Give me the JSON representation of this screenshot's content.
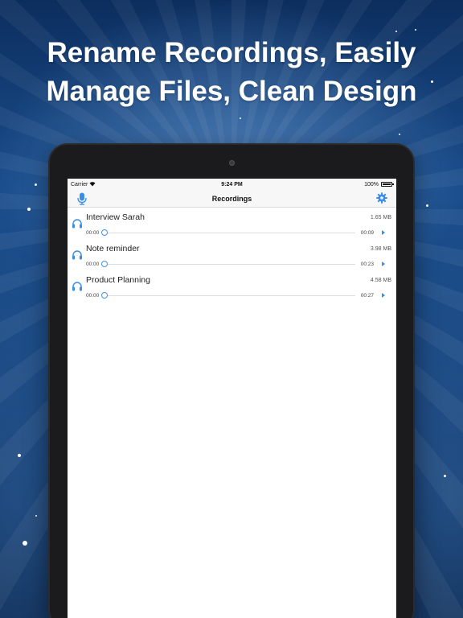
{
  "headline": {
    "line1": "Rename Recordings, Easily",
    "line2": "Manage Files, Clean Design"
  },
  "status_bar": {
    "carrier": "Carrier",
    "wifi_icon": "wifi-icon",
    "time": "9:24 PM",
    "battery": "100%"
  },
  "nav": {
    "title": "Recordings",
    "left_icon": "microphone-icon",
    "right_icon": "gear-icon"
  },
  "recordings": [
    {
      "name": "Interview Sarah",
      "size": "1.65 MB",
      "current": "00:00",
      "duration": "00:09"
    },
    {
      "name": "Note reminder",
      "size": "3.98 MB",
      "current": "00:00",
      "duration": "00:23"
    },
    {
      "name": "Product Planning",
      "size": "4.58 MB",
      "current": "00:00",
      "duration": "00:27"
    }
  ],
  "colors": {
    "accent": "#3a8ee6",
    "background_top": "#0c2e5e",
    "background_mid": "#1a4d8c"
  }
}
